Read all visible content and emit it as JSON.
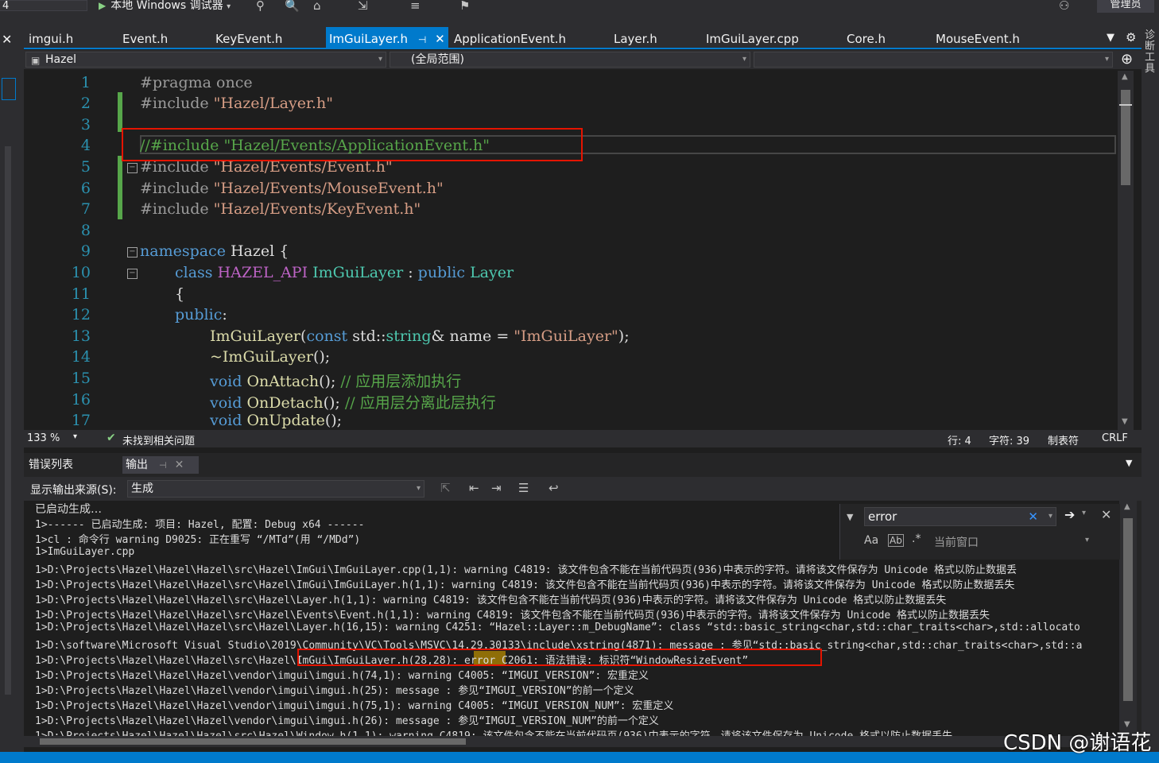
{
  "toolbar": {
    "config_value": "4",
    "debugger_label": "本地 Windows 调试器",
    "admin_label": "管理员"
  },
  "tabs": [
    {
      "label": "imgui.h"
    },
    {
      "label": "Event.h"
    },
    {
      "label": "KeyEvent.h"
    },
    {
      "label": "ImGuiLayer.h"
    },
    {
      "label": "ApplicationEvent.h"
    },
    {
      "label": "Layer.h"
    },
    {
      "label": "ImGuiLayer.cpp"
    },
    {
      "label": "Core.h"
    },
    {
      "label": "MouseEvent.h"
    }
  ],
  "navbar": {
    "project": "Hazel",
    "scope": "(全局范围)"
  },
  "right_strip_label": "诊断工具",
  "editor": {
    "line_numbers": [
      "1",
      "2",
      "3",
      "4",
      "5",
      "6",
      "7",
      "8",
      "9",
      "10",
      "11",
      "12",
      "13",
      "14",
      "15",
      "16",
      "17"
    ],
    "lines": {
      "l1": {
        "pp": "#pragma once"
      },
      "l2": {
        "pp": "#include ",
        "str": "\"Hazel/Layer.h\""
      },
      "l4": {
        "cm": "//#include ",
        "str": "\"Hazel/Events/ApplicationEvent.h\""
      },
      "l5": {
        "pp": "#include ",
        "str": "\"Hazel/Events/Event.h\""
      },
      "l6": {
        "pp": "#include ",
        "str": "\"Hazel/Events/MouseEvent.h\""
      },
      "l7": {
        "pp": "#include ",
        "str": "\"Hazel/Events/KeyEvent.h\""
      },
      "l9": {
        "kw": "namespace",
        "rest": " Hazel {"
      },
      "l10": {
        "kw": "class",
        "macro": "HAZEL_API",
        "type": "ImGuiLayer",
        "sep": " : ",
        "kw2": "public",
        "type2": "Layer"
      },
      "l11": {
        "text": "{"
      },
      "l12": {
        "kw": "public",
        "rest": ":"
      },
      "l13": {
        "fn": "ImGuiLayer",
        "open": "(",
        "kw": "const",
        "ns": " std::",
        "type": "string",
        "rest": "& name = ",
        "str": "\"ImGuiLayer\"",
        "close": ");"
      },
      "l14": {
        "fn": "~ImGuiLayer",
        "rest": "();"
      },
      "l15": {
        "kw": "void",
        "fn": " OnAttach",
        "rest": "(); ",
        "cm": "// 应用层添加执行"
      },
      "l16": {
        "kw": "void",
        "fn": " OnDetach",
        "rest": "(); ",
        "cm": "// 应用层分离此层执行"
      },
      "l17": {
        "kw": "void",
        "fn": " OnUpdate",
        "rest": "();"
      }
    }
  },
  "editor_status": {
    "zoom": "133 %",
    "issues": "未找到相关问题",
    "line": "行: 4",
    "char": "字符: 39",
    "tab": "制表符",
    "eol": "CRLF"
  },
  "output_panel": {
    "tab_errors": "错误列表",
    "tab_output": "输出",
    "source_label": "显示输出来源(S):",
    "source_value": "生成",
    "find_value": "error",
    "find_scope": "当前窗口",
    "lines": [
      "已启动生成…",
      "1>------ 已启动生成: 项目: Hazel, 配置: Debug x64 ------",
      "1>cl : 命令行 warning D9025: 正在重写 “/MTd”(用 “/MDd”)",
      "1>ImGuiLayer.cpp",
      "1>D:\\Projects\\Hazel\\Hazel\\Hazel\\src\\Hazel\\ImGui\\ImGuiLayer.cpp(1,1): warning C4819: 该文件包含不能在当前代码页(936)中表示的字符。请将该文件保存为 Unicode 格式以防止数据丢",
      "1>D:\\Projects\\Hazel\\Hazel\\Hazel\\src\\Hazel\\ImGui\\ImGuiLayer.h(1,1): warning C4819: 该文件包含不能在当前代码页(936)中表示的字符。请将该文件保存为 Unicode 格式以防止数据丢失",
      "1>D:\\Projects\\Hazel\\Hazel\\Hazel\\src\\Hazel\\Layer.h(1,1): warning C4819: 该文件包含不能在当前代码页(936)中表示的字符。请将该文件保存为 Unicode 格式以防止数据丢失",
      "1>D:\\Projects\\Hazel\\Hazel\\Hazel\\src\\Hazel\\Events\\Event.h(1,1): warning C4819: 该文件包含不能在当前代码页(936)中表示的字符。请将该文件保存为 Unicode 格式以防止数据丢失",
      "1>D:\\Projects\\Hazel\\Hazel\\Hazel\\src\\Hazel\\Layer.h(16,15): warning C4251: “Hazel::Layer::m_DebugName”: class “std::basic_string<char,std::char_traits<char>,std::allocato",
      "1>D:\\software\\Microsoft Visual Studio\\2019\\Community\\VC\\Tools\\MSVC\\14.29.30133\\include\\xstring(4871): message : 参见“std::basic_string<char,std::char_traits<char>,std::a",
      "1>D:\\Projects\\Hazel\\Hazel\\Hazel\\src\\Hazel\\ImGui\\ImGuiLayer.h(28,28): error C2061: 语法错误: 标识符“WindowResizeEvent”",
      "1>D:\\Projects\\Hazel\\Hazel\\Hazel\\vendor\\imgui\\imgui.h(74,1): warning C4005: “IMGUI_VERSION”: 宏重定义",
      "1>D:\\Projects\\Hazel\\Hazel\\Hazel\\vendor\\imgui\\imgui.h(25): message : 参见“IMGUI_VERSION”的前一个定义",
      "1>D:\\Projects\\Hazel\\Hazel\\Hazel\\vendor\\imgui\\imgui.h(75,1): warning C4005: “IMGUI_VERSION_NUM”: 宏重定义",
      "1>D:\\Projects\\Hazel\\Hazel\\Hazel\\vendor\\imgui\\imgui.h(26): message : 参见“IMGUI_VERSION_NUM”的前一个定义",
      "1>D:\\Projects\\Hazel\\Hazel\\Hazel\\src\\Hazel\\Window.h(1,1): warning C4819: 该文件包含不能在当前代码页(936)中表示的字符。请将该文件保存为 Unicode 格式以防止数据丢失"
    ]
  },
  "watermark": "CSDN @谢语花",
  "colors": {
    "accent": "#007acc",
    "highlight_box": "#e51400",
    "search_match": "#b58900"
  }
}
